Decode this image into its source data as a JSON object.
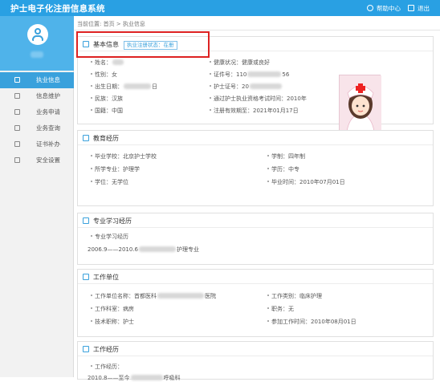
{
  "app": {
    "title": "护士电子化注册信息系统"
  },
  "topbar": {
    "help_label": "帮助中心",
    "logout_label": "退出"
  },
  "sidebar": {
    "user_name": "",
    "items": [
      {
        "label": "执业信息",
        "active": true
      },
      {
        "label": "信息维护"
      },
      {
        "label": "业务申请"
      },
      {
        "label": "业务查询"
      },
      {
        "label": "证书补办"
      },
      {
        "label": "安全设置"
      }
    ]
  },
  "breadcrumb": "当前位置: 首页 > 执业信息",
  "basic": {
    "title": "基本信息",
    "status_link": "执业注册状态：在册",
    "name": "姓名：",
    "gender": "性别：女",
    "birth": "出生日期：",
    "birth_suffix": "日",
    "ethnicity": "民族：汉族",
    "nationality": "国籍：中国",
    "health": "健康状况：健康或良好",
    "id_no": "证件号：110",
    "id_suffix": "56",
    "cert_no": "护士证号：20",
    "exam_year": "通过护士执业资格考试时间：2010年",
    "expiry": "注册有效期至：2021年01月17日"
  },
  "education": {
    "title": "教育经历",
    "school": "毕业学校：北京护士学校",
    "major": "所学专业：护理学",
    "degree": "学位：无学位",
    "length": "学制：四年制",
    "level": "学历：中专",
    "grad_time": "毕业时间：2010年07月01日"
  },
  "study": {
    "title": "专业学习经历",
    "label": "专业学习经历",
    "record_prefix": "2006.9——2010.6",
    "record_suffix": "护理专业"
  },
  "work_unit": {
    "title": "工作单位",
    "unit_name": "工作单位名称：首都医科",
    "unit_suffix": "医院",
    "department": "工作科室：病房",
    "tech_title": "技术职称：护士",
    "unit_type": "工作类别：临床护理",
    "position": "职务：无",
    "start_time": "参加工作时间：2010年08月01日"
  },
  "work_history": {
    "title": "工作经历",
    "label": "工作经历：",
    "record_prefix": "2010.8——至今",
    "record_suffix": "呼吸科"
  },
  "colors": {
    "primary": "#29a0e3",
    "highlight": "#dd2222",
    "sidebar_active": "#3aa1dc"
  }
}
